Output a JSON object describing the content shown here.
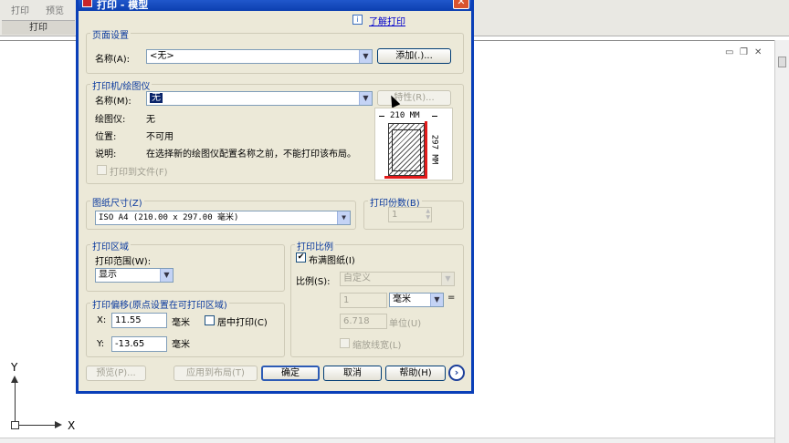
{
  "ribbon": {
    "tab_print": "打印",
    "tab_preview": "预览",
    "group_label": "打印"
  },
  "axis": {
    "y": "Y",
    "x": "X"
  },
  "dialog": {
    "title": "打印 - 模型",
    "learn_link": "了解打印",
    "page_setup": {
      "group": "页面设置",
      "name_label": "名称(A):",
      "name_value": "<无>",
      "add_button": "添加(.)..."
    },
    "printer": {
      "group": "打印机/绘图仪",
      "name_label": "名称(M):",
      "name_value": "无",
      "properties_button": "特性(R)...",
      "plotter_label": "绘图仪:",
      "plotter_value": "无",
      "location_label": "位置:",
      "location_value": "不可用",
      "desc_label": "说明:",
      "desc_value": "在选择新的绘图仪配置名称之前，不能打印该布局。",
      "print_to_file": "打印到文件(F)",
      "preview_width": "210 MM",
      "preview_height": "297 MM"
    },
    "paper_size": {
      "group": "图纸尺寸(Z)",
      "value": "ISO A4 (210.00 x 297.00 毫米)"
    },
    "copies": {
      "group": "打印份数(B)",
      "value": "1"
    },
    "plot_area": {
      "group": "打印区域",
      "range_label": "打印范围(W):",
      "range_value": "显示"
    },
    "plot_scale": {
      "group": "打印比例",
      "fit_paper": "布满图纸(I)",
      "scale_label": "比例(S):",
      "scale_value": "自定义",
      "value1": "1",
      "unit1": "毫米",
      "eq": "=",
      "value2": "6.718",
      "unit2": "单位(U)",
      "scale_lineweights": "缩放线宽(L)"
    },
    "plot_offset": {
      "group": "打印偏移(原点设置在可打印区域)",
      "x_label": "X:",
      "x_value": "11.55",
      "x_unit": "毫米",
      "y_label": "Y:",
      "y_value": "-13.65",
      "y_unit": "毫米",
      "center_plot": "居中打印(C)"
    },
    "buttons": {
      "preview": "预览(P)...",
      "apply_layout": "应用到布局(T)",
      "ok": "确定",
      "cancel": "取消",
      "help": "帮助(H)"
    }
  }
}
